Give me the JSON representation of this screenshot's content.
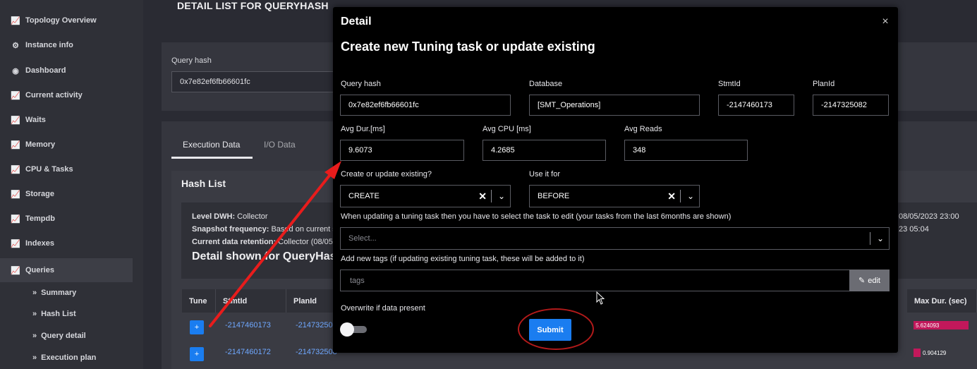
{
  "sidebar": {
    "items": [
      {
        "label": "Topology Overview",
        "icon": "chart-icon"
      },
      {
        "label": "Instance info",
        "icon": "gear-icon"
      },
      {
        "label": "Dashboard",
        "icon": "palette-icon"
      },
      {
        "label": "Current activity",
        "icon": "chart-icon"
      },
      {
        "label": "Waits",
        "icon": "chart-icon"
      },
      {
        "label": "Memory",
        "icon": "chart-icon"
      },
      {
        "label": "CPU & Tasks",
        "icon": "chart-icon"
      },
      {
        "label": "Storage",
        "icon": "chart-icon"
      },
      {
        "label": "Tempdb",
        "icon": "chart-icon"
      },
      {
        "label": "Indexes",
        "icon": "chart-icon"
      },
      {
        "label": "Queries",
        "icon": "chart-icon"
      }
    ],
    "sub_items": [
      "Summary",
      "Hash List",
      "Query detail",
      "Execution plan"
    ]
  },
  "page": {
    "title": "DETAIL LIST FOR QUERYHASH",
    "query_hash_label": "Query hash",
    "query_hash_value": "0x7e82ef6fb66601fc",
    "tabs": [
      "Execution Data",
      "I/O Data"
    ],
    "hash_list_title": "Hash List",
    "info": {
      "level_label": "Level DWH:",
      "level_value": " Collector",
      "snapshot_label": "Snapshot frequency:",
      "snapshot_value": " Based on current s",
      "retention_label": "Current data retention:",
      "retention_value": " Collector (08/05/"
    },
    "detail_shown": "Detail shown for QueryHas",
    "right_line1": "08/05/2023 23:00",
    "right_line2": "23 05:04"
  },
  "table": {
    "headers": [
      "Tune",
      "StmtId",
      "PlanId",
      "Max Dur. (sec)"
    ],
    "rows": [
      {
        "stmt": "-2147460173",
        "plan": "-21473250",
        "max_dur": "5.624093"
      },
      {
        "stmt": "-2147460172",
        "plan": "-214732508",
        "max_dur": "0.904129"
      }
    ],
    "tune_label": "+"
  },
  "modal": {
    "header": "Detail",
    "close": "×",
    "subtitle": "Create new Tuning task or update existing",
    "fields": {
      "query_hash": {
        "label": "Query hash",
        "value": "0x7e82ef6fb66601fc"
      },
      "database": {
        "label": "Database",
        "value": "[SMT_Operations]"
      },
      "stmt_id": {
        "label": "StmtId",
        "value": "-2147460173"
      },
      "plan_id": {
        "label": "PlanId",
        "value": "-2147325082"
      },
      "avg_dur": {
        "label": "Avg Dur.[ms]",
        "value": "9.6073"
      },
      "avg_cpu": {
        "label": "Avg CPU [ms]",
        "value": "4.2685"
      },
      "avg_reads": {
        "label": "Avg Reads",
        "value": "348"
      }
    },
    "create_or_update": {
      "label": "Create or update existing?",
      "value": "CREATE"
    },
    "use_it_for": {
      "label": "Use it for",
      "value": "BEFORE"
    },
    "task_select": {
      "label": "When updating a tuning task then you have to select the task to edit (your tasks from the last 6months are shown)",
      "placeholder": "Select..."
    },
    "tags": {
      "label": "Add new tags (if updating existing tuning task, these will be added to it)",
      "placeholder": "tags",
      "edit_label": "edit"
    },
    "overwrite": {
      "label": "Overwrite if data present",
      "enabled": false
    },
    "submit_label": "Submit"
  },
  "colors": {
    "accent": "#1a7df0",
    "annotation": "#e81c1c",
    "bar_pink": "#c2185b",
    "bar_orange": "#f57c00"
  }
}
